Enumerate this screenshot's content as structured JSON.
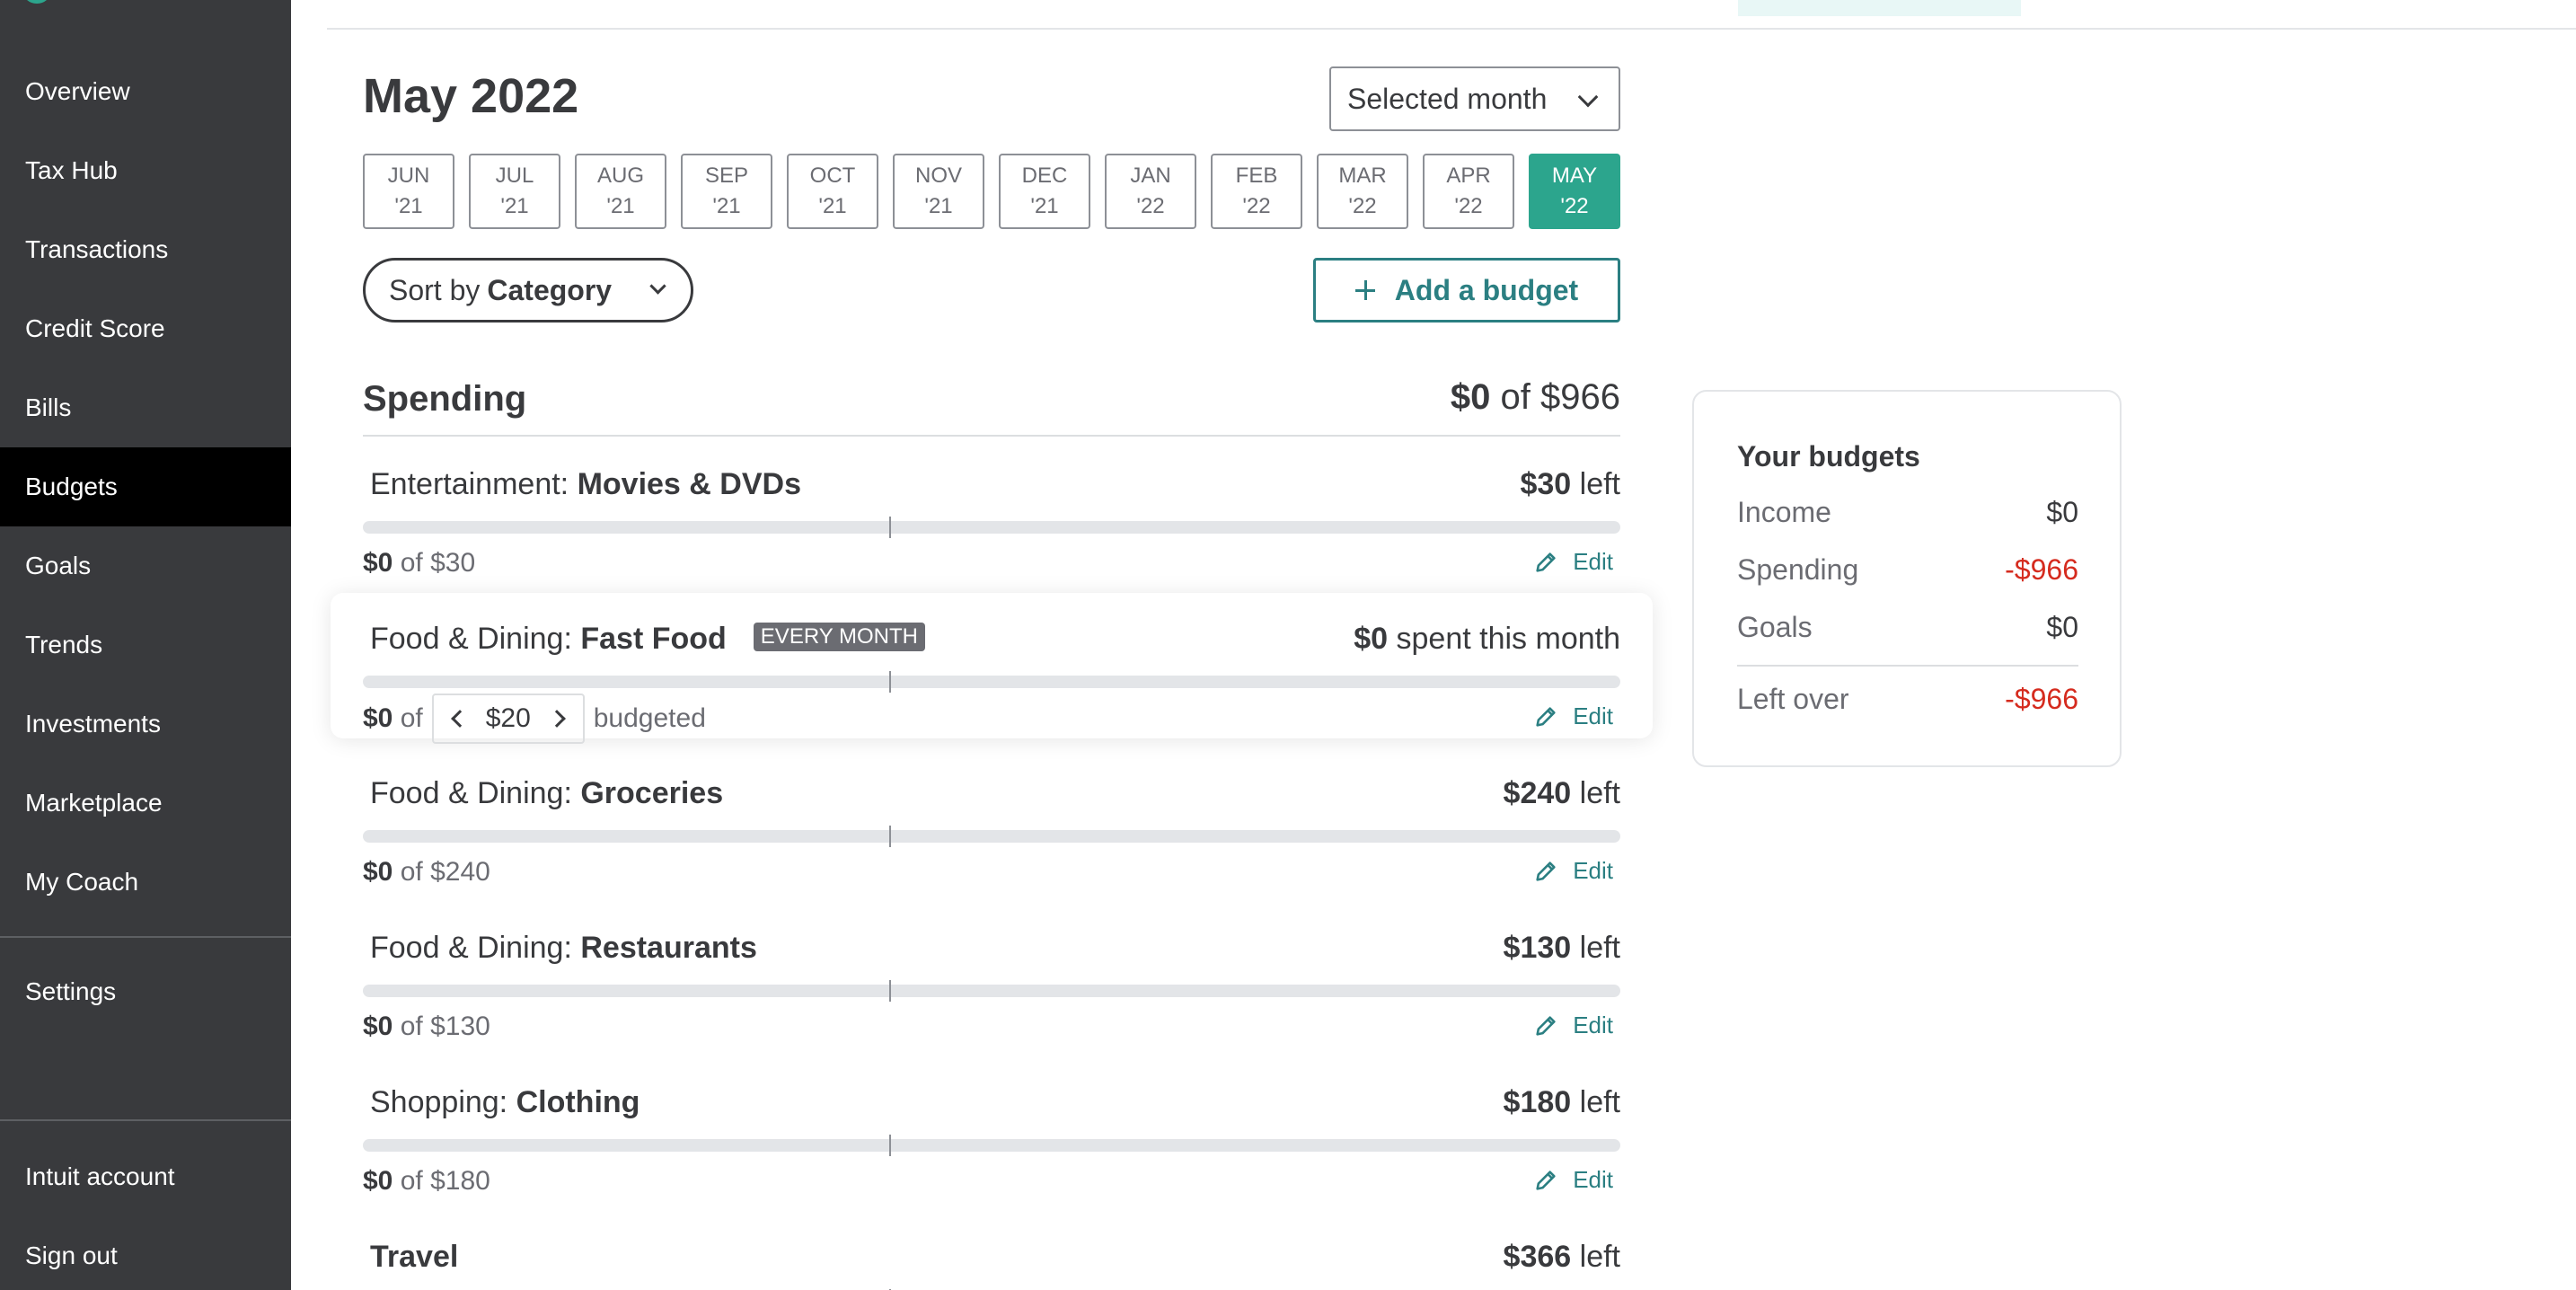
{
  "sidebar": {
    "items": [
      {
        "label": "Overview"
      },
      {
        "label": "Tax Hub"
      },
      {
        "label": "Transactions"
      },
      {
        "label": "Credit Score"
      },
      {
        "label": "Bills"
      },
      {
        "label": "Budgets",
        "active": true
      },
      {
        "label": "Goals"
      },
      {
        "label": "Trends"
      },
      {
        "label": "Investments"
      },
      {
        "label": "Marketplace"
      },
      {
        "label": "My Coach"
      }
    ],
    "settings_label": "Settings",
    "account_label": "Intuit account",
    "signout_label": "Sign out"
  },
  "header": {
    "title": "May 2022",
    "month_select": "Selected month"
  },
  "months": [
    {
      "m": "JUN",
      "y": "'21"
    },
    {
      "m": "JUL",
      "y": "'21"
    },
    {
      "m": "AUG",
      "y": "'21"
    },
    {
      "m": "SEP",
      "y": "'21"
    },
    {
      "m": "OCT",
      "y": "'21"
    },
    {
      "m": "NOV",
      "y": "'21"
    },
    {
      "m": "DEC",
      "y": "'21"
    },
    {
      "m": "JAN",
      "y": "'22"
    },
    {
      "m": "FEB",
      "y": "'22"
    },
    {
      "m": "MAR",
      "y": "'22"
    },
    {
      "m": "APR",
      "y": "'22"
    },
    {
      "m": "MAY",
      "y": "'22",
      "active": true
    }
  ],
  "controls": {
    "sort_prefix": "Sort by",
    "sort_value": "Category",
    "add_label": "Add a budget"
  },
  "spending": {
    "title": "Spending",
    "spent": "$0",
    "of_total": "of $966",
    "budgets": [
      {
        "category": "Entertainment:",
        "sub": "Movies & DVDs",
        "left_amt": "$30",
        "left_label": "left",
        "spent": "$0",
        "of": "of $30",
        "edit": "Edit",
        "progress": 0
      },
      {
        "category": "Food & Dining:",
        "sub": "Fast Food",
        "badge": "EVERY MONTH",
        "left_amt": "$0",
        "left_label": "spent this month",
        "spent": "$0",
        "of": "of",
        "stepper_value": "$20",
        "budgeted": "budgeted",
        "edit": "Edit",
        "progress": 0
      },
      {
        "category": "Food & Dining:",
        "sub": "Groceries",
        "left_amt": "$240",
        "left_label": "left",
        "spent": "$0",
        "of": "of $240",
        "edit": "Edit",
        "progress": 0
      },
      {
        "category": "Food & Dining:",
        "sub": "Restaurants",
        "left_amt": "$130",
        "left_label": "left",
        "spent": "$0",
        "of": "of $130",
        "edit": "Edit",
        "progress": 0
      },
      {
        "category": "Shopping:",
        "sub": "Clothing",
        "left_amt": "$180",
        "left_label": "left",
        "spent": "$0",
        "of": "of $180",
        "edit": "Edit",
        "progress": 0
      },
      {
        "category": "Travel",
        "left_amt": "$366",
        "left_label": "left"
      }
    ]
  },
  "summary": {
    "title": "Your budgets",
    "rows": [
      {
        "label": "Income",
        "value": "$0"
      },
      {
        "label": "Spending",
        "value": "-$966"
      },
      {
        "label": "Goals",
        "value": "$0"
      }
    ],
    "leftover_label": "Left over",
    "leftover_value": "-$966"
  },
  "colors": {
    "sidebar_bg": "#393a3d",
    "sidebar_active": "#000000",
    "accent": "#2ca58d",
    "link": "#2b7f82",
    "negative": "#d52b1e"
  }
}
